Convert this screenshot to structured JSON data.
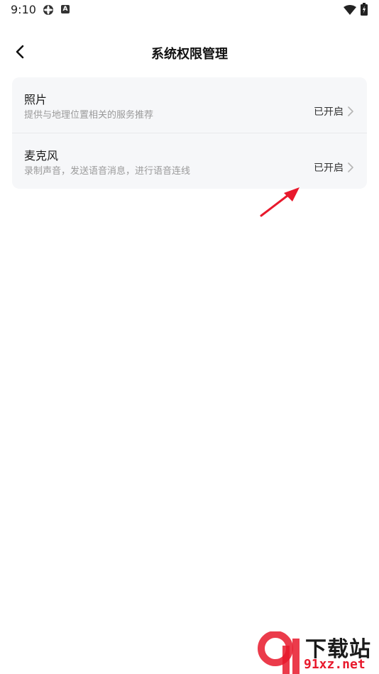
{
  "status_bar": {
    "time": "9:10",
    "icons": [
      "gear-icon",
      "a-badge-icon",
      "wifi-icon",
      "battery-icon"
    ],
    "badge_letter": "A"
  },
  "header": {
    "title": "系统权限管理",
    "back_icon": "chevron-left-icon"
  },
  "permissions": [
    {
      "title": "照片",
      "description": "提供与地理位置相关的服务推荐",
      "status": "已开启"
    },
    {
      "title": "麦克风",
      "description": "录制声音，发送语音消息，进行语音连线",
      "status": "已开启"
    }
  ],
  "annotation": {
    "icon": "red-arrow-icon",
    "color": "#e8192c"
  },
  "watermark": {
    "title": "下载站",
    "url": "91xz.net",
    "logo_text": "9",
    "accent": "#e8192c"
  }
}
